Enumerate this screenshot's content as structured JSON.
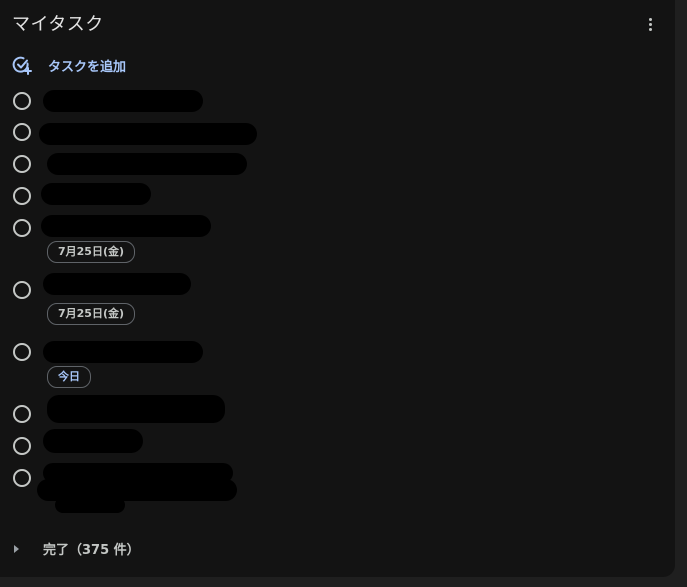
{
  "header": {
    "title": "マイタスク"
  },
  "add_task": {
    "label": "タスクを追加"
  },
  "tasks": [
    {
      "due": ""
    },
    {
      "due": ""
    },
    {
      "due": ""
    },
    {
      "due": ""
    },
    {
      "due": "7月25日(金)"
    },
    {
      "due": "7月25日(金)"
    },
    {
      "due": "今日"
    },
    {
      "due": ""
    },
    {
      "due": ""
    },
    {
      "due": ""
    }
  ],
  "completed": {
    "label": "完了（375 件）"
  },
  "colors": {
    "background": "#131313",
    "accent": "#a8c7fa",
    "text": "#e3e3e3",
    "chip_border": "#5f6368"
  }
}
